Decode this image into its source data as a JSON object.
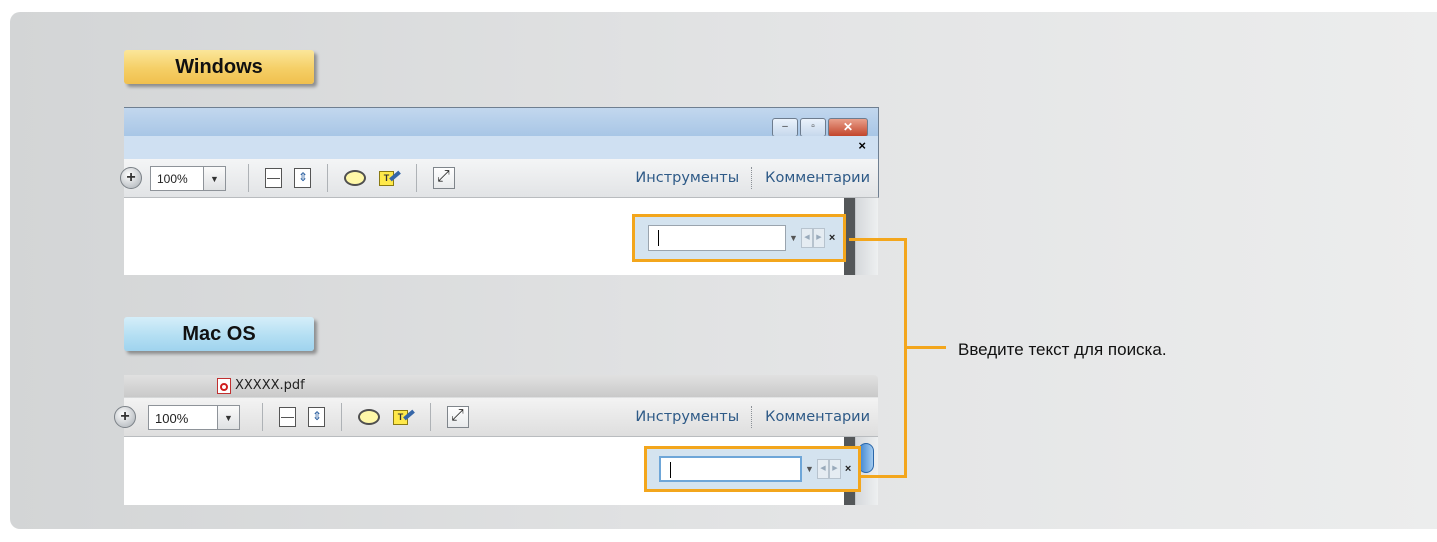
{
  "labels": {
    "windows": "Windows",
    "mac": "Mac OS"
  },
  "windows_window": {
    "title_buttons": [
      "minimize",
      "maximize",
      "close"
    ],
    "close_doc": "×",
    "toolbar": {
      "zoom_value": "100%",
      "tools_label": "Инструменты",
      "comments_label": "Комментарии"
    },
    "findbar": {
      "value": "",
      "close": "×"
    }
  },
  "mac_window": {
    "title": "XXXXX.pdf",
    "toolbar": {
      "zoom_value": "100%",
      "tools_label": "Инструменты",
      "comments_label": "Комментарии"
    },
    "findbar": {
      "value": "",
      "close": "×"
    }
  },
  "callout": {
    "text": "Введите текст для поиска.",
    "color": "#f3a61c"
  }
}
